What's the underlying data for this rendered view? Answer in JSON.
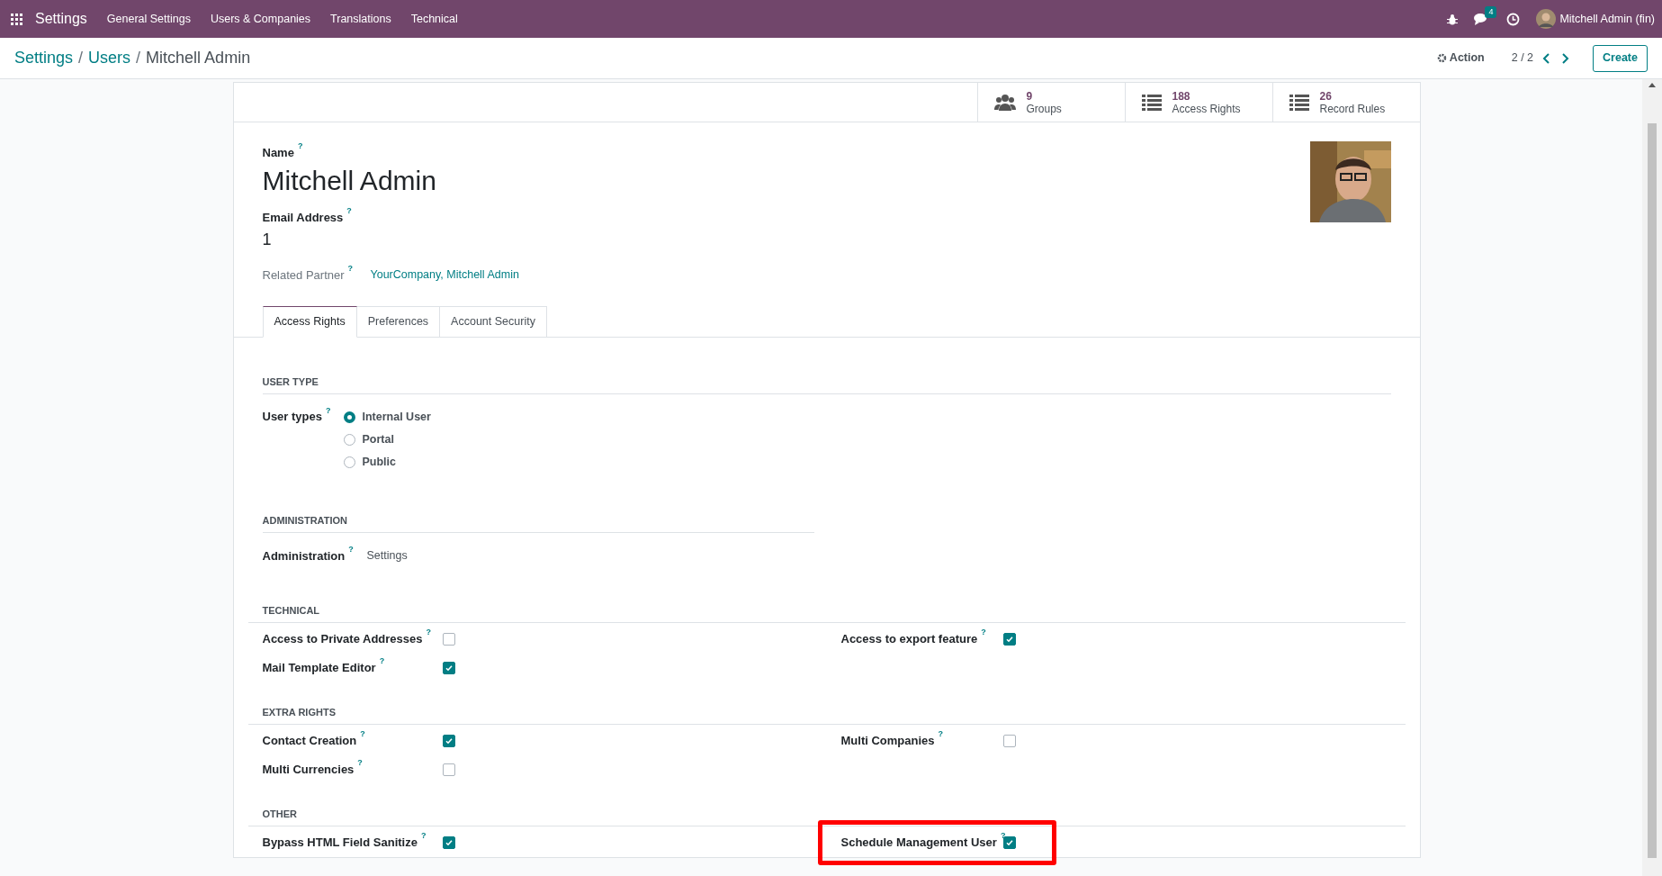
{
  "navbar": {
    "app": "Settings",
    "menu": [
      "General Settings",
      "Users & Companies",
      "Translations",
      "Technical"
    ],
    "messages_badge": "4",
    "user": "Mitchell Admin (fin)"
  },
  "control_panel": {
    "breadcrumbs": [
      {
        "label": "Settings",
        "separator": "/"
      },
      {
        "label": "Users",
        "separator": "/"
      },
      {
        "label": "Mitchell Admin"
      }
    ],
    "action": "Action",
    "pager": "2 / 2",
    "create": "Create"
  },
  "stat_buttons": [
    {
      "kind": "groups",
      "value": "9",
      "label": "Groups"
    },
    {
      "kind": "list",
      "value": "188",
      "label": "Access Rights"
    },
    {
      "kind": "list",
      "value": "26",
      "label": "Record Rules"
    }
  ],
  "form": {
    "name_label": "Name",
    "name_help": "?",
    "name": "Mitchell Admin",
    "email_label": "Email Address",
    "email_help": "?",
    "email": "1",
    "partner_label": "Related Partner",
    "partner_help": "?",
    "partner": "YourCompany, Mitchell Admin"
  },
  "tabs": [
    {
      "label": "Access Rights",
      "selected": true
    },
    {
      "label": "Preferences",
      "selected": false
    },
    {
      "label": "Account Security",
      "selected": false
    }
  ],
  "user_type": {
    "title": "USER TYPE",
    "label": "User types",
    "help": "?",
    "options": [
      {
        "label": "Internal User",
        "selected": true
      },
      {
        "label": "Portal",
        "selected": false
      },
      {
        "label": "Public",
        "selected": false
      }
    ]
  },
  "administration": {
    "title": "ADMINISTRATION",
    "label": "Administration",
    "help": "?",
    "value": "Settings"
  },
  "checkbox_sections": [
    {
      "title": "TECHNICAL",
      "left": [
        {
          "label": "Access to Private Addresses",
          "help": "?",
          "checked": false,
          "highlighted": false
        },
        {
          "label": "Mail Template Editor",
          "help": "?",
          "checked": true,
          "highlighted": false
        }
      ],
      "right": [
        {
          "label": "Access to export feature",
          "help": "?",
          "checked": true,
          "highlighted": false
        }
      ]
    },
    {
      "title": "EXTRA RIGHTS",
      "left": [
        {
          "label": "Contact Creation",
          "help": "?",
          "checked": true,
          "highlighted": false
        },
        {
          "label": "Multi Currencies",
          "help": "?",
          "checked": false,
          "highlighted": false
        }
      ],
      "right": [
        {
          "label": "Multi Companies",
          "help": "?",
          "checked": false,
          "highlighted": false
        }
      ]
    },
    {
      "title": "OTHER",
      "left": [
        {
          "label": "Bypass HTML Field Sanitize",
          "help": "?",
          "checked": true,
          "highlighted": false
        }
      ],
      "right": [
        {
          "label": "Schedule Management User",
          "help": "?",
          "checked": true,
          "highlighted": true
        }
      ]
    }
  ]
}
